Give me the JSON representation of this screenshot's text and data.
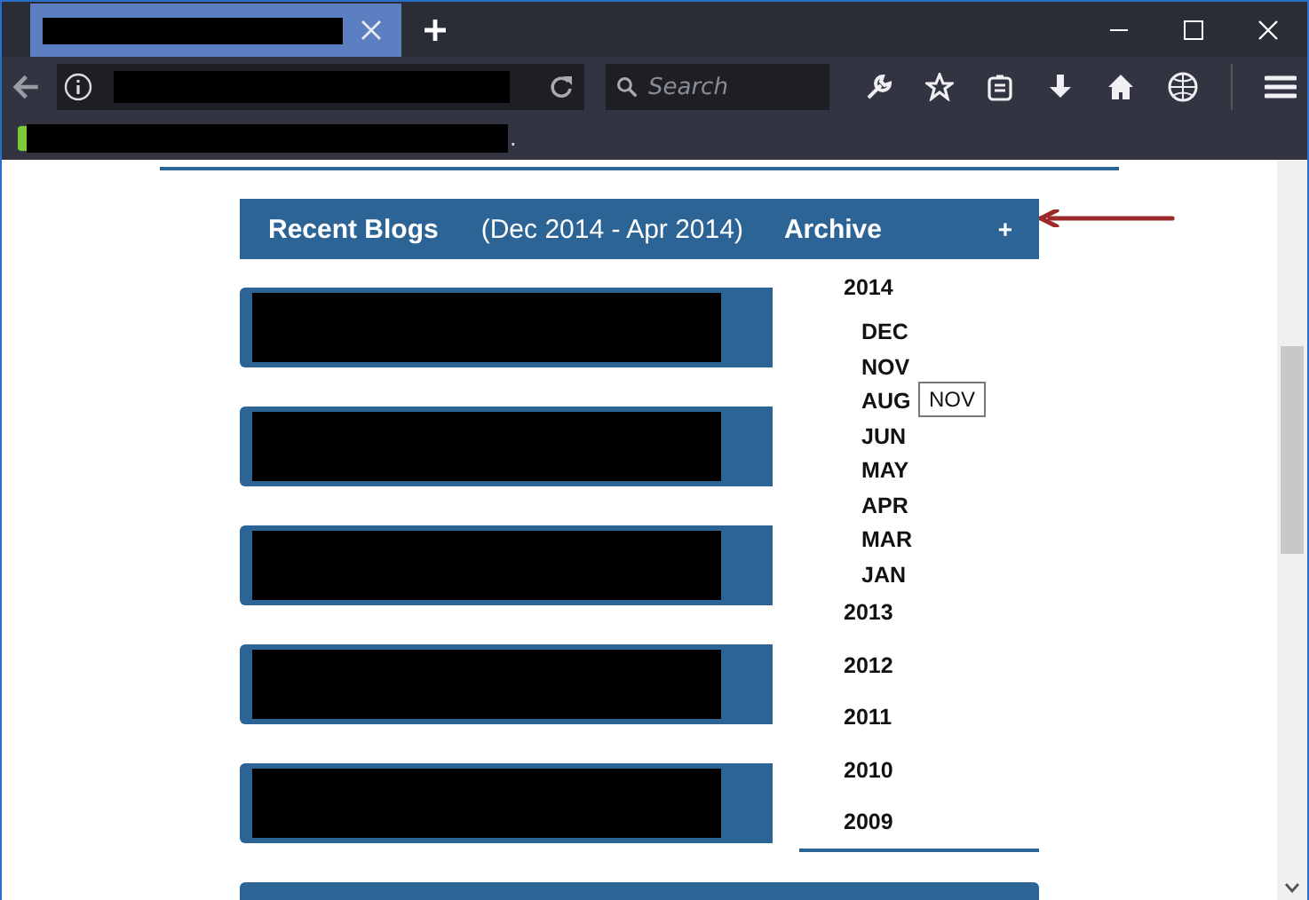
{
  "browser": {
    "tabs": [
      {
        "title_redacted": true,
        "selected": true
      }
    ],
    "search": {
      "placeholder": "Search"
    },
    "bookmark_tail": "."
  },
  "blog": {
    "header": {
      "title": "Recent Blogs",
      "range": "(Dec 2014 - Apr 2014)",
      "archive": "Archive",
      "toggle": "+"
    },
    "cards": [
      {
        "redacted": true
      },
      {
        "redacted": true
      },
      {
        "redacted": true
      },
      {
        "redacted": true
      },
      {
        "redacted": true
      }
    ],
    "archive": [
      {
        "label": "2014",
        "children": [
          {
            "label": "DEC"
          },
          {
            "label": "NOV"
          },
          {
            "label": "AUG"
          },
          {
            "label": "JUN"
          },
          {
            "label": "MAY"
          },
          {
            "label": "APR"
          },
          {
            "label": "MAR"
          },
          {
            "label": "JAN"
          }
        ]
      },
      {
        "label": "2013"
      },
      {
        "label": "2012"
      },
      {
        "label": "2011"
      },
      {
        "label": "2010"
      },
      {
        "label": "2009"
      }
    ],
    "tooltip": "NOV"
  }
}
